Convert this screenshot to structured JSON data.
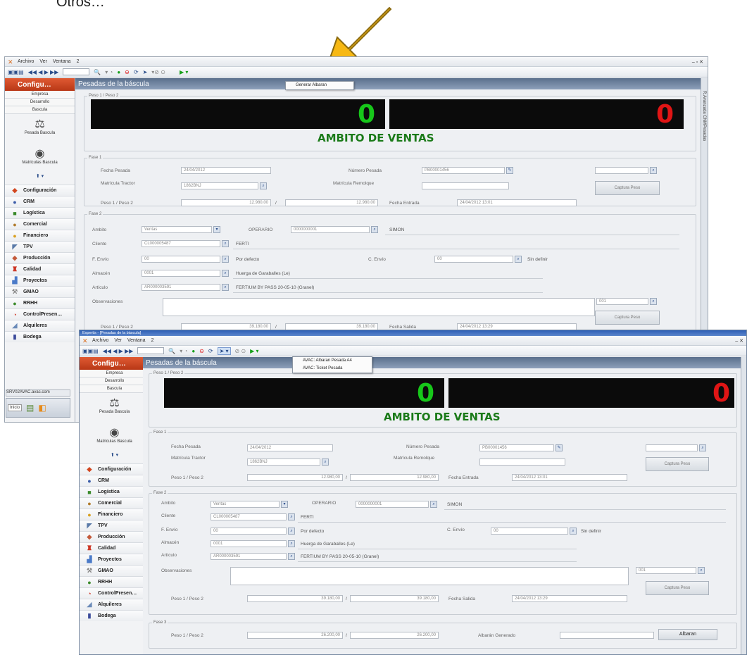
{
  "caption": "Otros…",
  "menu": {
    "archivo": "Archivo",
    "ver": "Ver",
    "ventana": "Ventana",
    "num": "2"
  },
  "sidebar": {
    "header": "Configu…",
    "subitems": [
      "Empresa",
      "Desarrollo",
      "Bascula"
    ],
    "big": [
      "Pesada Bascula",
      "Matriculas Bascula"
    ],
    "nav": [
      "Configuración",
      "CRM",
      "Logística",
      "Comercial",
      "Financiero",
      "TPV",
      "Producción",
      "Calidad",
      "Proyectos",
      "GMAO",
      "RRHH",
      "ControlPresen…",
      "Alquileres",
      "Bodega"
    ]
  },
  "win1": {
    "title": "Pesadas de la báscula",
    "dropdown": [
      "Generar Albaran"
    ],
    "side_tab": "R.Avanzada CNMPesadas",
    "host": "SRV02AVAC.avac.com",
    "inicio": "Inicio"
  },
  "win2": {
    "titlebar": "Expertis - [Pesadas de la báscula]",
    "title": "Pesadas de la báscula",
    "dropdown": [
      "AVAC: Albaran Pesada A4",
      "AVAC: Ticket Pesada"
    ]
  },
  "form": {
    "peso_legend": "Peso 1 / Peso 2",
    "display_left": "0",
    "display_right": "0",
    "ambito": "AMBITO DE VENTAS",
    "fase1": "Fase 1",
    "fecha_pesada_lbl": "Fecha Pesada",
    "fecha_pesada": "24/04/2012",
    "numero_pesada_lbl": "Número Pesada",
    "numero_pesada": "PB00001456",
    "matricula_tractor_lbl": "Matrícula Tractor",
    "matricula_tractor": "1862BNJ",
    "matricula_remolque_lbl": "Matrícula Remolque",
    "peso12_lbl": "Peso 1 / Peso 2",
    "peso1": "12.980,00",
    "slash": "/",
    "peso2": "12.980,00",
    "fecha_entrada_lbl": "Fecha Entrada",
    "fecha_entrada": "24/04/2012 13:01",
    "captura_peso": "Captura Peso",
    "fase2": "Fase 2",
    "ambito_lbl": "Ambito",
    "ambito_val": "Ventas",
    "operario_lbl": "OPERARIO",
    "operario": "0000000001",
    "operario_name": "SIMON",
    "cliente_lbl": "Cliente",
    "cliente": "CL000005487",
    "cliente_name": "FERTI",
    "fenvio_lbl": "F. Envío",
    "fenvio": "00",
    "fenvio_desc": "Por defecto",
    "cenvio_lbl": "C. Envío",
    "cenvio": "00",
    "cenvio_desc": "Sin definir",
    "almacen_lbl": "Almacén",
    "almacen": "0001",
    "almacen_desc": "Huerga de Garaballes (Le)",
    "articulo_lbl": "Artículo",
    "articulo": "AR000003591",
    "articulo_desc": "FERTIUM BY PASS 20-05-10 (Granel)",
    "obs_lbl": "Observaciones",
    "obs_code": "001",
    "peso1b": "39.180,00",
    "peso2b": "39.180,00",
    "fecha_salida_lbl": "Fecha Salida",
    "fecha_salida": "24/04/2012 13:29",
    "fase3": "Fase 3",
    "peso1c": "26.200,00",
    "peso2c": "26.200,00",
    "albaran_gen_lbl": "Albarán Generado",
    "albaran_btn": "Albaran"
  }
}
